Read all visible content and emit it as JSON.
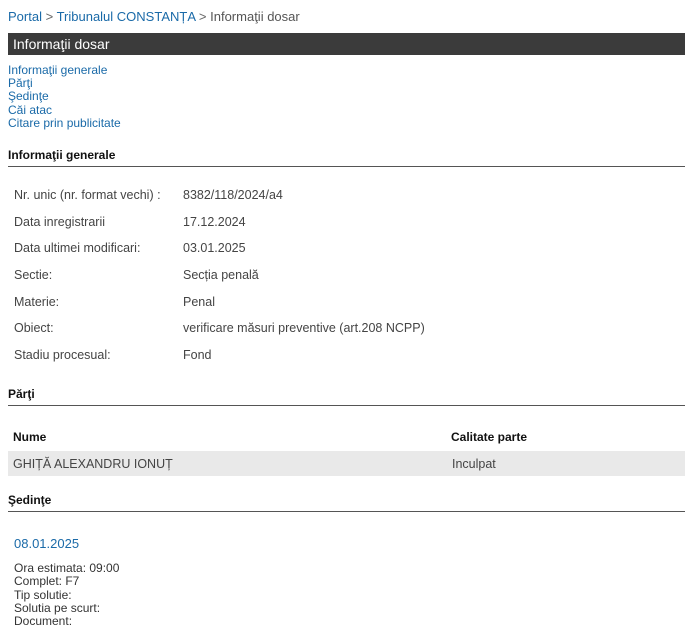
{
  "breadcrumb": {
    "portal": "Portal",
    "sep": ">",
    "court": "Tribunalul CONSTANȚA",
    "current": "Informaţii dosar"
  },
  "page_title": "Informaţii dosar",
  "anchors": [
    "Informaţii generale",
    "Părţi",
    "Şedinţe",
    "Căi atac",
    "Citare prin publicitate"
  ],
  "info": {
    "heading": "Informaţii generale",
    "rows": [
      {
        "label": "Nr. unic (nr. format vechi) :",
        "value": "8382/118/2024/a4"
      },
      {
        "label": "Data inregistrarii",
        "value": "17.12.2024"
      },
      {
        "label": "Data ultimei modificari:",
        "value": "03.01.2025"
      },
      {
        "label": "Sectie:",
        "value": "Secția penală"
      },
      {
        "label": "Materie:",
        "value": "Penal"
      },
      {
        "label": "Obiect:",
        "value": "verificare măsuri preventive (art.208 NCPP)"
      },
      {
        "label": "Stadiu procesual:",
        "value": "Fond"
      }
    ]
  },
  "parti": {
    "heading": "Părţi",
    "columns": [
      "Nume",
      "Calitate parte"
    ],
    "rows": [
      {
        "nume": "GHIȚĂ ALEXANDRU IONUȚ",
        "calitate": "Inculpat"
      }
    ]
  },
  "sedinte": {
    "heading": "Şedinţe",
    "date": "08.01.2025",
    "details": [
      "Ora estimata: 09:00",
      "Complet: F7",
      "Tip solutie:",
      "Solutia pe scurt:",
      "Document:"
    ]
  }
}
